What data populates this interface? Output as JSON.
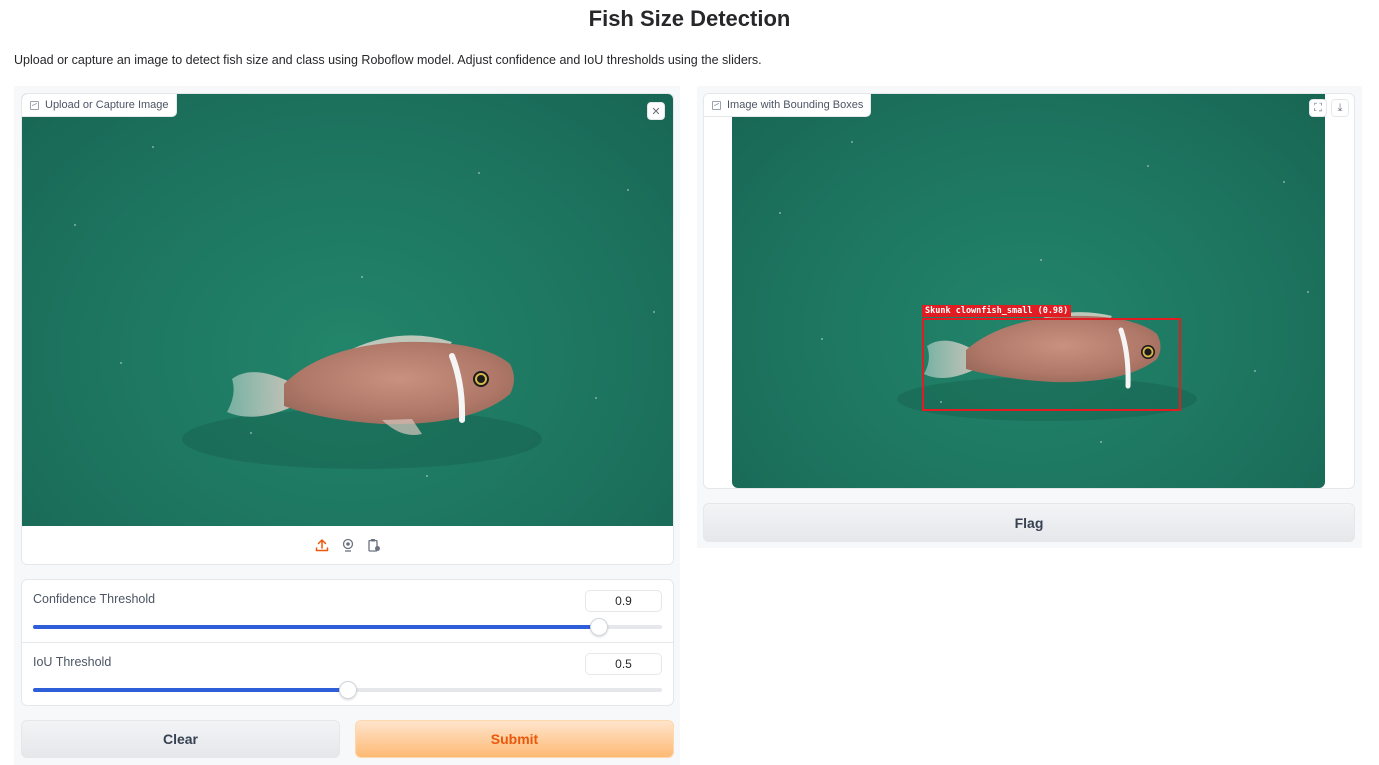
{
  "page": {
    "title": "Fish Size Detection",
    "description": "Upload or capture an image to detect fish size and class using Roboflow model. Adjust confidence and IoU thresholds using the sliders."
  },
  "input_image": {
    "label": "Upload or Capture Image",
    "clear_icon": "close-icon",
    "source_icons": [
      "upload-icon",
      "webcam-icon",
      "clipboard-icon"
    ]
  },
  "output_image": {
    "label": "Image with Bounding Boxes",
    "fullscreen_icon": "fullscreen-icon",
    "download_icon": "download-icon",
    "detection": {
      "label": "Skunk clownfish_small (0.98)"
    }
  },
  "sliders": {
    "confidence": {
      "label": "Confidence Threshold",
      "value": "0.9",
      "fraction": 0.9
    },
    "iou": {
      "label": "IoU Threshold",
      "value": "0.5",
      "fraction": 0.5
    }
  },
  "buttons": {
    "clear": "Clear",
    "submit": "Submit",
    "flag": "Flag"
  },
  "colors": {
    "accent": "#ea580c",
    "slider": "#2f5fd8",
    "bbox": "#e11d24"
  }
}
